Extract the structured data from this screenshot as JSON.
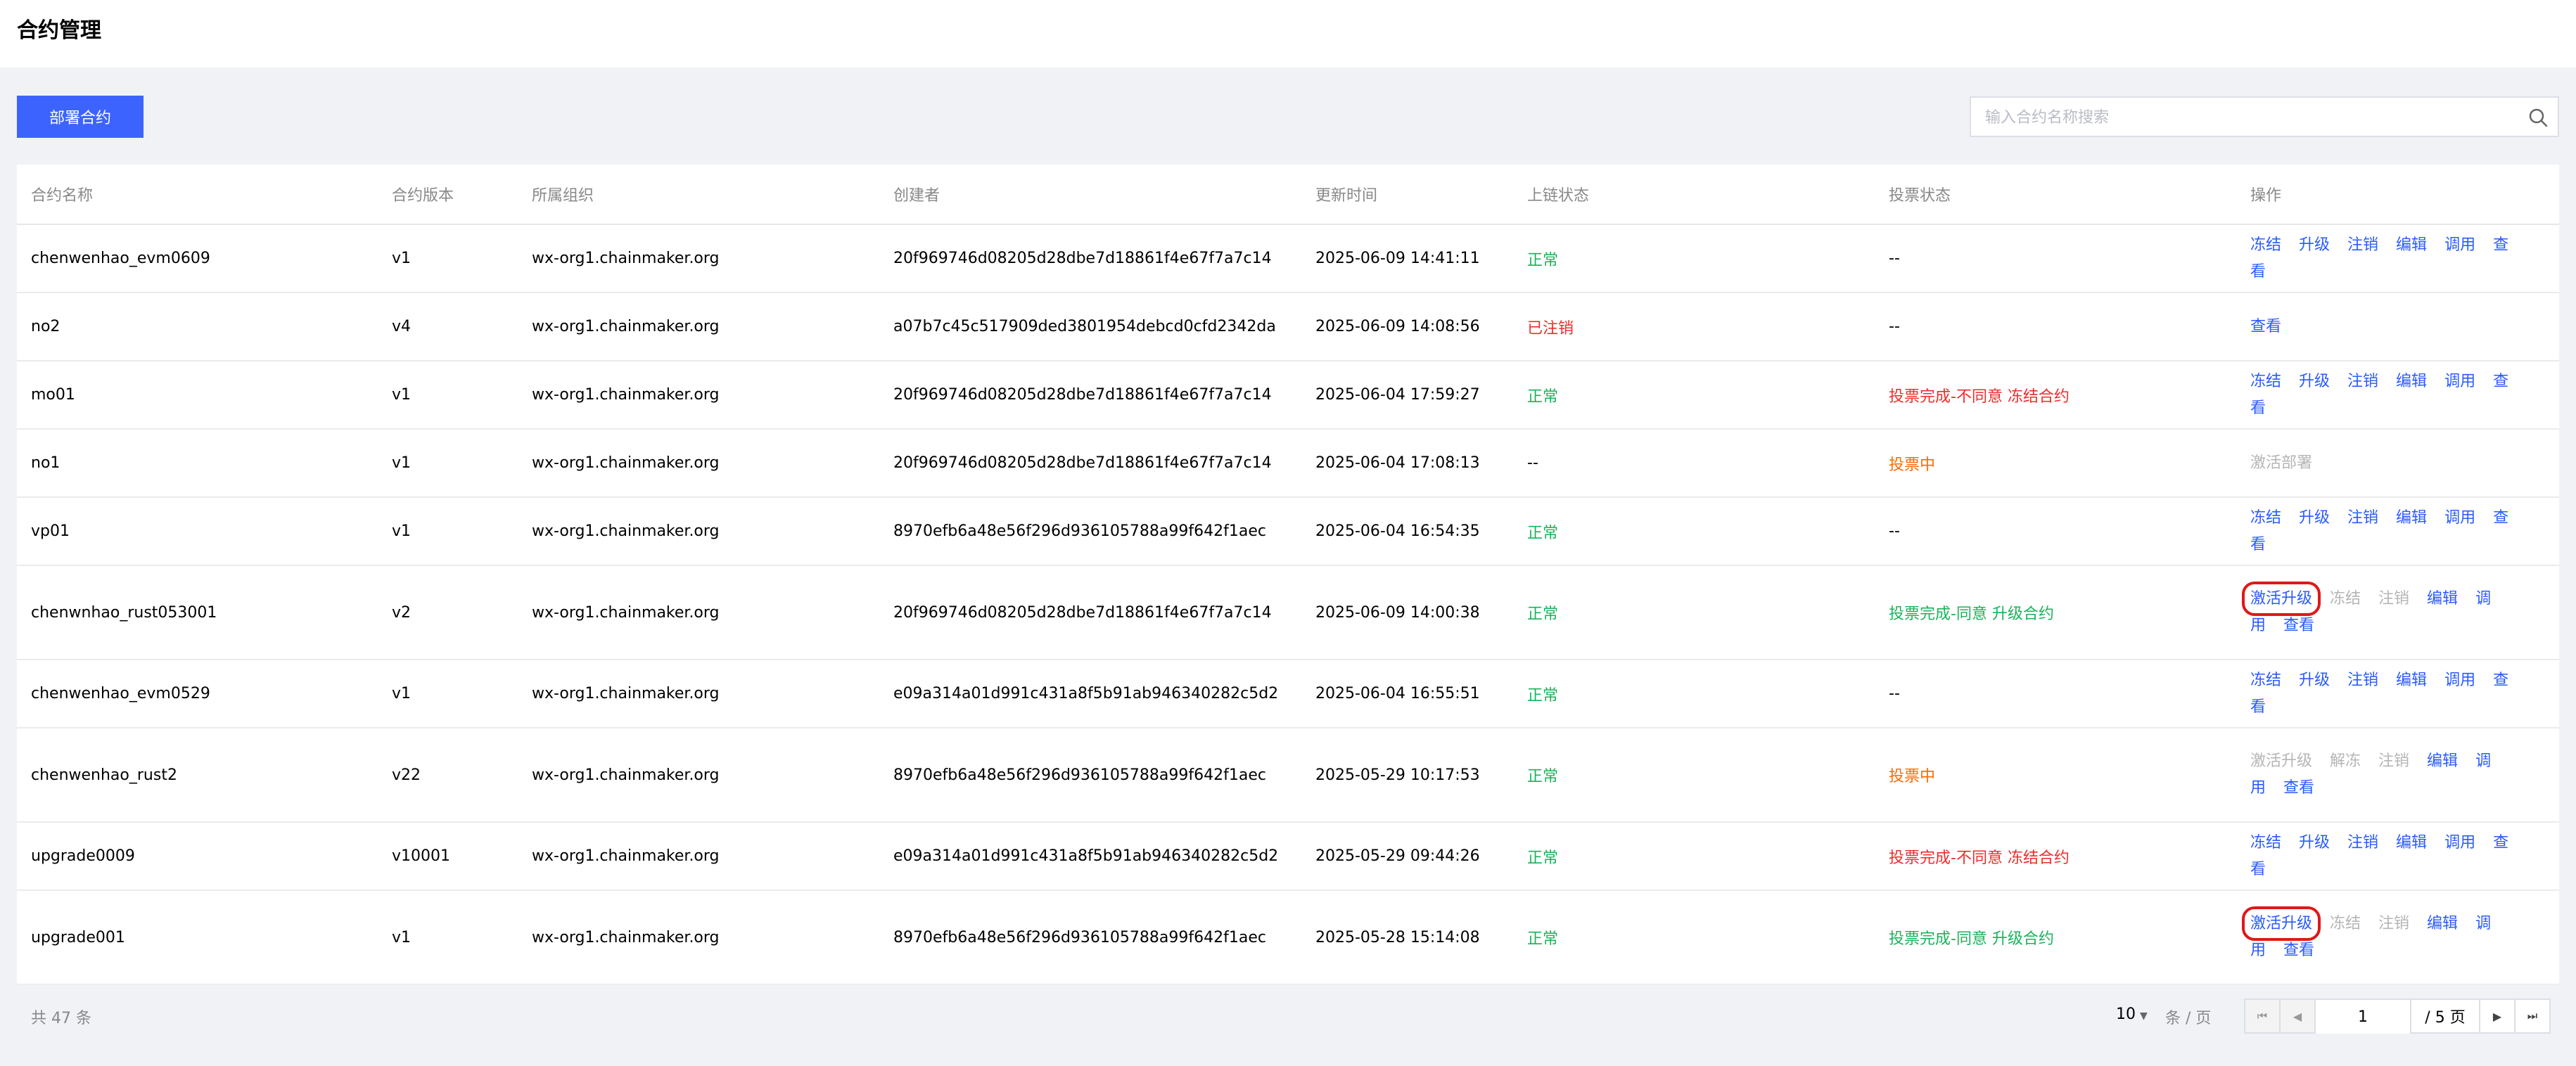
{
  "header": {
    "title": "合约管理"
  },
  "toolbar": {
    "deploy_label": "部署合约"
  },
  "search": {
    "placeholder": "输入合约名称搜索",
    "value": ""
  },
  "table": {
    "columns": [
      "合约名称",
      "合约版本",
      "所属组织",
      "创建者",
      "更新时间",
      "上链状态",
      "投票状态",
      "操作"
    ],
    "rows": [
      {
        "name": "chenwenhao_evm0609",
        "version": "v1",
        "org": "wx-org1.chainmaker.org",
        "creator": "20f969746d08205d28dbe7d18861f4e67f7a7c14",
        "updated": "2025-06-09 14:41:11",
        "chain_status": "正常",
        "vote_status": "--",
        "actions": [
          "冻结",
          "升级",
          "注销",
          "编辑",
          "调用",
          "查看"
        ]
      },
      {
        "name": "no2",
        "version": "v4",
        "org": "wx-org1.chainmaker.org",
        "creator": "a07b7c45c517909ded3801954debcd0cfd2342da",
        "updated": "2025-06-09 14:08:56",
        "chain_status": "已注销",
        "vote_status": "--",
        "actions": [
          "查看"
        ]
      },
      {
        "name": "mo01",
        "version": "v1",
        "org": "wx-org1.chainmaker.org",
        "creator": "20f969746d08205d28dbe7d18861f4e67f7a7c14",
        "updated": "2025-06-04 17:59:27",
        "chain_status": "正常",
        "vote_status": "投票完成-不同意 冻结合约",
        "actions": [
          "冻结",
          "升级",
          "注销",
          "编辑",
          "调用",
          "查看"
        ]
      },
      {
        "name": "no1",
        "version": "v1",
        "org": "wx-org1.chainmaker.org",
        "creator": "20f969746d08205d28dbe7d18861f4e67f7a7c14",
        "updated": "2025-06-04 17:08:13",
        "chain_status": "--",
        "vote_status": "投票中",
        "actions": [
          "激活部署"
        ]
      },
      {
        "name": "vp01",
        "version": "v1",
        "org": "wx-org1.chainmaker.org",
        "creator": "8970efb6a48e56f296d936105788a99f642f1aec",
        "updated": "2025-06-04 16:54:35",
        "chain_status": "正常",
        "vote_status": "--",
        "actions": [
          "冻结",
          "升级",
          "注销",
          "编辑",
          "调用",
          "查看"
        ]
      },
      {
        "name": "chenwnhao_rust053001",
        "version": "v2",
        "org": "wx-org1.chainmaker.org",
        "creator": "20f969746d08205d28dbe7d18861f4e67f7a7c14",
        "updated": "2025-06-09 14:00:38",
        "chain_status": "正常",
        "vote_status": "投票完成-同意 升级合约",
        "actions": [
          "激活升级",
          "冻结",
          "注销",
          "编辑",
          "调用",
          "查看"
        ]
      },
      {
        "name": "chenwenhao_evm0529",
        "version": "v1",
        "org": "wx-org1.chainmaker.org",
        "creator": "e09a314a01d991c431a8f5b91ab946340282c5d2",
        "updated": "2025-06-04 16:55:51",
        "chain_status": "正常",
        "vote_status": "--",
        "actions": [
          "冻结",
          "升级",
          "注销",
          "编辑",
          "调用",
          "查看"
        ]
      },
      {
        "name": "chenwenhao_rust2",
        "version": "v22",
        "org": "wx-org1.chainmaker.org",
        "creator": "8970efb6a48e56f296d936105788a99f642f1aec",
        "updated": "2025-05-29 10:17:53",
        "chain_status": "正常",
        "vote_status": "投票中",
        "actions": [
          "激活升级",
          "解冻",
          "注销",
          "编辑",
          "调用",
          "查看"
        ]
      },
      {
        "name": "upgrade0009",
        "version": "v10001",
        "org": "wx-org1.chainmaker.org",
        "creator": "e09a314a01d991c431a8f5b91ab946340282c5d2",
        "updated": "2025-05-29 09:44:26",
        "chain_status": "正常",
        "vote_status": "投票完成-不同意 冻结合约",
        "actions": [
          "冻结",
          "升级",
          "注销",
          "编辑",
          "调用",
          "查看"
        ]
      },
      {
        "name": "upgrade001",
        "version": "v1",
        "org": "wx-org1.chainmaker.org",
        "creator": "8970efb6a48e56f296d936105788a99f642f1aec",
        "updated": "2025-05-28 15:14:08",
        "chain_status": "正常",
        "vote_status": "投票完成-同意 升级合约",
        "actions": [
          "激活升级",
          "冻结",
          "注销",
          "编辑",
          "调用",
          "查看"
        ]
      }
    ]
  },
  "pagination": {
    "total_text": "共 47 条",
    "page_size": "10",
    "page_size_unit": "条 / 页",
    "current_page": "1",
    "total_pages_text": "/ 5 页"
  },
  "colors": {
    "primary": "#3d63ff",
    "link": "#2a5bff",
    "ok": "#19b35a",
    "danger": "#ef2b2b",
    "warning": "#ff6a00",
    "highlight_box": "#e01818"
  }
}
